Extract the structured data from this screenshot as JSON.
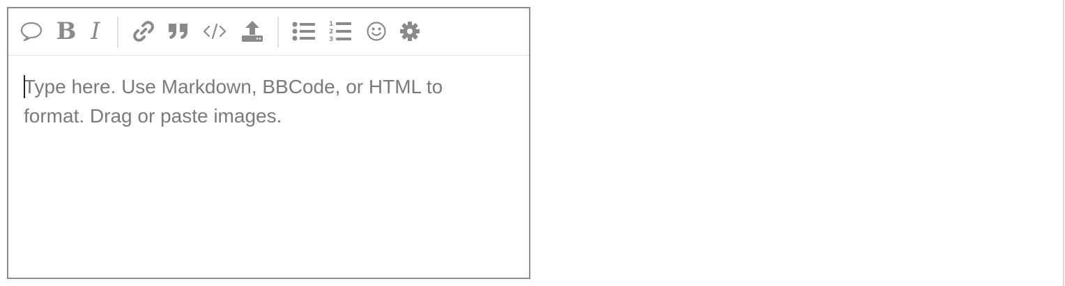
{
  "editor": {
    "toolbar": {
      "buttons": [
        {
          "name": "quote-bubble",
          "icon": "speech-bubble-icon"
        },
        {
          "name": "bold",
          "icon": "bold-icon",
          "glyph": "B"
        },
        {
          "name": "italic",
          "icon": "italic-icon",
          "glyph": "I"
        },
        {
          "name": "link",
          "icon": "link-icon"
        },
        {
          "name": "blockquote",
          "icon": "quote-icon"
        },
        {
          "name": "code",
          "icon": "code-icon"
        },
        {
          "name": "upload",
          "icon": "upload-icon"
        },
        {
          "name": "bullet-list",
          "icon": "bullet-list-icon"
        },
        {
          "name": "numbered-list",
          "icon": "numbered-list-icon"
        },
        {
          "name": "emoji",
          "icon": "smiley-icon"
        },
        {
          "name": "settings",
          "icon": "gear-icon"
        }
      ],
      "icon_color": "#8a8a8a"
    },
    "placeholder": "Type here. Use Markdown, BBCode, or HTML to format. Drag or paste images."
  }
}
